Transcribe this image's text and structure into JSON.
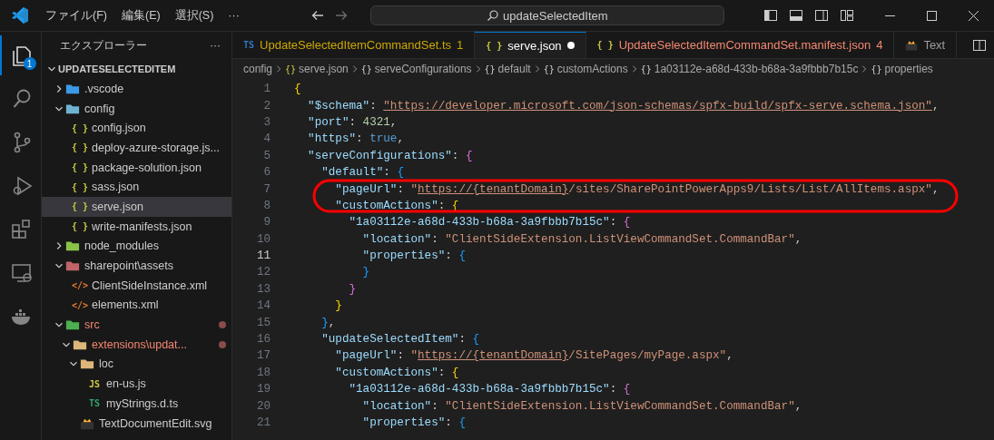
{
  "title_bar": {
    "menus": [
      "ファイル(F)",
      "編集(E)",
      "選択(S)",
      "···"
    ],
    "search": "updateSelectedItem"
  },
  "activity_bar": [
    {
      "kind": "explorer",
      "selected": true,
      "badge": "1"
    },
    {
      "kind": "search",
      "selected": false
    },
    {
      "kind": "source-control",
      "selected": false
    },
    {
      "kind": "debug",
      "selected": false
    },
    {
      "kind": "extensions",
      "selected": false
    },
    {
      "kind": "remote",
      "selected": false
    },
    {
      "kind": "docker",
      "selected": false
    }
  ],
  "sidebar": {
    "title": "エクスプローラー",
    "more": "···",
    "root": "UPDATESELECTEDITEM",
    "items": [
      {
        "label": ".vscode",
        "kind": "folder-vscode",
        "expanded": false,
        "selected": false,
        "modified": false
      },
      {
        "label": "config",
        "kind": "folder-config",
        "expanded": true,
        "selected": false,
        "modified": false,
        "children": [
          {
            "label": "config.json",
            "kind": "json",
            "icon": "{ }",
            "selected": false,
            "modified": false
          },
          {
            "label": "deploy-azure-storage.js...",
            "kind": "json",
            "icon": "{ }",
            "selected": false,
            "modified": false
          },
          {
            "label": "package-solution.json",
            "kind": "json",
            "icon": "{ }",
            "selected": false,
            "modified": false
          },
          {
            "label": "sass.json",
            "kind": "json",
            "icon": "{ }",
            "selected": false,
            "modified": false
          },
          {
            "label": "serve.json",
            "kind": "json",
            "icon": "{ }",
            "selected": true,
            "modified": false
          },
          {
            "label": "write-manifests.json",
            "kind": "json",
            "icon": "{ }",
            "selected": false,
            "modified": false
          }
        ]
      },
      {
        "label": "node_modules",
        "kind": "folder-node",
        "expanded": false,
        "selected": false,
        "modified": false
      },
      {
        "label": "sharepoint\\assets",
        "kind": "folder-sharepoint",
        "expanded": true,
        "selected": false,
        "modified": false,
        "children": [
          {
            "label": "ClientSideInstance.xml",
            "kind": "xml",
            "icon": "</>",
            "selected": false,
            "modified": false
          },
          {
            "label": "elements.xml",
            "kind": "xml",
            "icon": "</>",
            "selected": false,
            "modified": false
          }
        ]
      },
      {
        "label": "src",
        "kind": "folder-src",
        "expanded": true,
        "selected": false,
        "modified": true,
        "children": [
          {
            "label": "extensions\\updat...",
            "kind": "folder",
            "expanded": true,
            "selected": false,
            "modified": true,
            "children": [
              {
                "label": "loc",
                "kind": "folder",
                "expanded": true,
                "selected": false,
                "modified": false,
                "children": [
                  {
                    "label": "en-us.js",
                    "kind": "js",
                    "icon": "JS",
                    "selected": false,
                    "modified": false
                  },
                  {
                    "label": "myStrings.d.ts",
                    "kind": "ts",
                    "icon": "TS",
                    "selected": false,
                    "modified": false
                  }
                ]
              },
              {
                "label": "TextDocumentEdit.svg",
                "kind": "svg",
                "selected": false,
                "modified": false
              }
            ]
          }
        ]
      }
    ]
  },
  "tabs": [
    {
      "label": "UpdateSelectedItemCommandSet.ts",
      "kind": "ts",
      "icon": "TS",
      "warning": true,
      "error": false,
      "badge": "1",
      "selected": false,
      "dirty": false
    },
    {
      "label": "serve.json",
      "kind": "json",
      "icon": "{ }",
      "warning": false,
      "error": false,
      "selected": true,
      "dirty": true
    },
    {
      "label": "UpdateSelectedItemCommandSet.manifest.json",
      "kind": "json",
      "icon": "{ }",
      "warning": false,
      "error": true,
      "badge": "4",
      "selected": false,
      "dirty": false
    },
    {
      "label": "Text",
      "kind": "svg",
      "warning": false,
      "error": false,
      "selected": false,
      "dirty": false
    }
  ],
  "breadcrumb": [
    {
      "label": "config"
    },
    {
      "label": "serve.json",
      "kind": "file",
      "icon": "{}"
    },
    {
      "label": "serveConfigurations",
      "kind": "object",
      "icon": "{}"
    },
    {
      "label": "default",
      "kind": "object",
      "icon": "{}"
    },
    {
      "label": "customActions",
      "kind": "object",
      "icon": "{}"
    },
    {
      "label": "1a03112e-a68d-433b-b68a-3a9fbbb7b15c",
      "kind": "object",
      "icon": "{}"
    },
    {
      "label": "properties",
      "kind": "object",
      "icon": "{}"
    }
  ],
  "code": [
    {
      "n": "1",
      "current": false,
      "tokens": [
        {
          "kind": "brace1",
          "text": "{"
        }
      ]
    },
    {
      "n": "2",
      "current": false,
      "tokens": [
        {
          "kind": "key",
          "text": "  \"$schema\""
        },
        {
          "kind": "punct",
          "text": ": "
        },
        {
          "kind": "link",
          "text": "\"https://developer.microsoft.com/json-schemas/spfx-build/spfx-serve.schema.json\""
        },
        {
          "kind": "punct",
          "text": ","
        }
      ]
    },
    {
      "n": "3",
      "current": false,
      "tokens": [
        {
          "kind": "key",
          "text": "  \"port\""
        },
        {
          "kind": "punct",
          "text": ": "
        },
        {
          "kind": "num",
          "text": "4321"
        },
        {
          "kind": "punct",
          "text": ","
        }
      ]
    },
    {
      "n": "4",
      "current": false,
      "tokens": [
        {
          "kind": "key",
          "text": "  \"https\""
        },
        {
          "kind": "punct",
          "text": ": "
        },
        {
          "kind": "bool",
          "text": "true"
        },
        {
          "kind": "punct",
          "text": ","
        }
      ]
    },
    {
      "n": "5",
      "current": false,
      "tokens": [
        {
          "kind": "key",
          "text": "  \"serveConfigurations\""
        },
        {
          "kind": "punct",
          "text": ": "
        },
        {
          "kind": "brace2",
          "text": "{"
        }
      ]
    },
    {
      "n": "6",
      "current": false,
      "tokens": [
        {
          "kind": "key",
          "text": "    \"default\""
        },
        {
          "kind": "punct",
          "text": ": "
        },
        {
          "kind": "brace3",
          "text": "{"
        }
      ]
    },
    {
      "n": "7",
      "current": false,
      "tokens": [
        {
          "kind": "key",
          "text": "      \"pageUrl\""
        },
        {
          "kind": "punct",
          "text": ": "
        },
        {
          "kind": "str",
          "text": "\""
        },
        {
          "kind": "link",
          "text": "https://{tenantDomain}"
        },
        {
          "kind": "str",
          "text": "/sites/SharePointPowerApps9/Lists/List/AllItems.aspx\""
        },
        {
          "kind": "punct",
          "text": ","
        }
      ]
    },
    {
      "n": "8",
      "current": false,
      "tokens": [
        {
          "kind": "key",
          "text": "      \"customActions\""
        },
        {
          "kind": "punct",
          "text": ": "
        },
        {
          "kind": "brace1",
          "text": "{"
        }
      ]
    },
    {
      "n": "9",
      "current": false,
      "tokens": [
        {
          "kind": "key",
          "text": "        \"1a03112e-a68d-433b-b68a-3a9fbbb7b15c\""
        },
        {
          "kind": "punct",
          "text": ": "
        },
        {
          "kind": "brace2",
          "text": "{"
        }
      ]
    },
    {
      "n": "10",
      "current": false,
      "tokens": [
        {
          "kind": "key",
          "text": "          \"location\""
        },
        {
          "kind": "punct",
          "text": ": "
        },
        {
          "kind": "str",
          "text": "\"ClientSideExtension.ListViewCommandSet.CommandBar\""
        },
        {
          "kind": "punct",
          "text": ","
        }
      ]
    },
    {
      "n": "11",
      "current": true,
      "tokens": [
        {
          "kind": "key",
          "text": "          \"properties\""
        },
        {
          "kind": "punct",
          "text": ": "
        },
        {
          "kind": "brace3",
          "text": "{"
        }
      ]
    },
    {
      "n": "12",
      "current": false,
      "tokens": [
        {
          "kind": "brace3",
          "text": "          }"
        }
      ]
    },
    {
      "n": "13",
      "current": false,
      "tokens": [
        {
          "kind": "brace2",
          "text": "        }"
        }
      ]
    },
    {
      "n": "14",
      "current": false,
      "tokens": [
        {
          "kind": "brace1",
          "text": "      }"
        }
      ]
    },
    {
      "n": "15",
      "current": false,
      "tokens": [
        {
          "kind": "brace3",
          "text": "    }"
        },
        {
          "kind": "punct",
          "text": ","
        }
      ]
    },
    {
      "n": "16",
      "current": false,
      "tokens": [
        {
          "kind": "key",
          "text": "    \"updateSelectedItem\""
        },
        {
          "kind": "punct",
          "text": ": "
        },
        {
          "kind": "brace3",
          "text": "{"
        }
      ]
    },
    {
      "n": "17",
      "current": false,
      "tokens": [
        {
          "kind": "key",
          "text": "      \"pageUrl\""
        },
        {
          "kind": "punct",
          "text": ": "
        },
        {
          "kind": "str",
          "text": "\""
        },
        {
          "kind": "link",
          "text": "https://{tenantDomain}"
        },
        {
          "kind": "str",
          "text": "/SitePages/myPage.aspx\""
        },
        {
          "kind": "punct",
          "text": ","
        }
      ]
    },
    {
      "n": "18",
      "current": false,
      "tokens": [
        {
          "kind": "key",
          "text": "      \"customActions\""
        },
        {
          "kind": "punct",
          "text": ": "
        },
        {
          "kind": "brace1",
          "text": "{"
        }
      ]
    },
    {
      "n": "19",
      "current": false,
      "tokens": [
        {
          "kind": "key",
          "text": "        \"1a03112e-a68d-433b-b68a-3a9fbbb7b15c\""
        },
        {
          "kind": "punct",
          "text": ": "
        },
        {
          "kind": "brace2",
          "text": "{"
        }
      ]
    },
    {
      "n": "20",
      "current": false,
      "tokens": [
        {
          "kind": "key",
          "text": "          \"location\""
        },
        {
          "kind": "punct",
          "text": ": "
        },
        {
          "kind": "str",
          "text": "\"ClientSideExtension.ListViewCommandSet.CommandBar\""
        },
        {
          "kind": "punct",
          "text": ","
        }
      ]
    },
    {
      "n": "21",
      "current": false,
      "tokens": [
        {
          "kind": "key",
          "text": "          \"properties\""
        },
        {
          "kind": "punct",
          "text": ": "
        },
        {
          "kind": "brace3",
          "text": "{"
        }
      ]
    }
  ]
}
